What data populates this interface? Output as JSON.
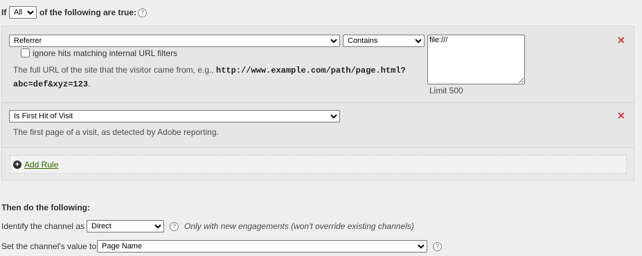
{
  "condition": {
    "prefix": "If",
    "match_select": {
      "selected": "All"
    },
    "suffix": "of the following are true:",
    "help_glyph": "?"
  },
  "rules": [
    {
      "field_select": {
        "selected": "Referrer"
      },
      "operator_select": {
        "selected": "Contains"
      },
      "value": "file:///",
      "limit_label": "Limit 500",
      "checkbox_label": "ignore hits matching internal URL filters",
      "checkbox_checked": false,
      "description_prefix": "The full URL of the site that the visitor came from, e.g.,",
      "description_example_line1": "http://www.example.com/path/page.html?",
      "description_example_line2": "abc=def&xyz=123",
      "description_suffix": "."
    },
    {
      "field_select": {
        "selected": "Is First Hit of Visit"
      },
      "description": "The first page of a visit, as detected by Adobe reporting."
    }
  ],
  "delete_glyph": "✕",
  "add_rule": {
    "label": "Add Rule",
    "icon": "plus-circle-icon"
  },
  "actions": {
    "heading": "Then do the following:",
    "channel_label": "Identify the channel as",
    "channel_select": {
      "selected": "Direct"
    },
    "channel_note": "Only with new engagements (won't override existing channels)",
    "value_label": "Set the channel's value to",
    "value_select": {
      "selected": "Page Name"
    }
  },
  "colors": {
    "background": "#eeeeee",
    "delete": "#d7373f",
    "link": "#2b6a00"
  }
}
